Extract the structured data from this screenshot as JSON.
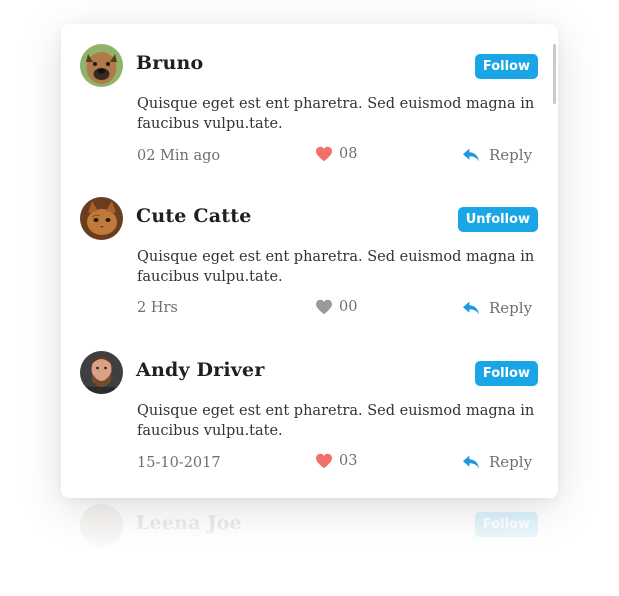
{
  "comments": [
    {
      "name": "Bruno",
      "avatar": "dog-avatar",
      "follow_label": "Follow",
      "text": "Quisque eget est ent pharetra. Sed euismod magna in faucibus vulpu.tate.",
      "time": "02 Min ago",
      "likes": "08",
      "liked": true,
      "reply_label": "Reply"
    },
    {
      "name": "Cute Catte",
      "avatar": "cat-avatar",
      "follow_label": "Unfollow",
      "text": "Quisque eget est ent pharetra. Sed euismod magna in faucibus vulpu.tate.",
      "time": "2 Hrs",
      "likes": "00",
      "liked": false,
      "reply_label": "Reply"
    },
    {
      "name": "Andy Driver",
      "avatar": "man-avatar",
      "follow_label": "Follow",
      "text": "Quisque eget est ent pharetra. Sed euismod magna in faucibus vulpu.tate.",
      "time": "15-10-2017",
      "likes": "03",
      "liked": true,
      "reply_label": "Reply"
    }
  ],
  "reflection": {
    "name": "Leena Joe",
    "follow_label": "Follow"
  },
  "colors": {
    "accent": "#1aa6e6",
    "like_active": "#f2706b",
    "like_inactive": "#9a9a9a",
    "reply_icon": "#1e96e0"
  }
}
